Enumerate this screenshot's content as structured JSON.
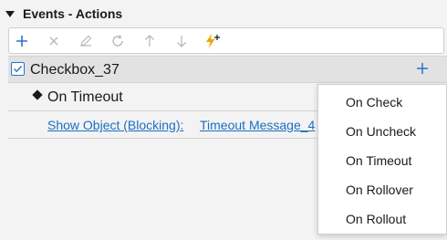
{
  "section": {
    "title": "Events - Actions"
  },
  "toolbar": {
    "buttons": [
      {
        "icon": "plus-icon",
        "color": "#2b73c9",
        "enabled": true
      },
      {
        "icon": "x-icon",
        "enabled": false
      },
      {
        "icon": "pencil-icon",
        "enabled": false
      },
      {
        "icon": "refresh-icon",
        "enabled": false
      },
      {
        "icon": "arrow-up-icon",
        "enabled": false
      },
      {
        "icon": "arrow-down-icon",
        "enabled": false
      },
      {
        "icon": "lightning-plus-icon",
        "color": "#f0a400",
        "enabled": true
      }
    ]
  },
  "object_row": {
    "label": "Checkbox_37",
    "checked": true
  },
  "event_row": {
    "label": "On Timeout"
  },
  "action_row": {
    "action": "Show Object (Blocking):",
    "target": "Timeout Message_4"
  },
  "dropdown": {
    "items": [
      "On Check",
      "On Uncheck",
      "On Timeout",
      "On Rollover",
      "On Rollout"
    ]
  },
  "colors": {
    "accent": "#2b73c9",
    "link": "#1a6fc4",
    "disabled": "#b9b9b9",
    "lightning": "#f0a400"
  }
}
